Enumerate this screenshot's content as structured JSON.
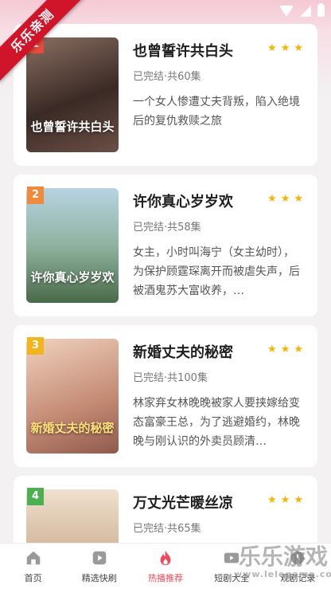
{
  "ribbon": {
    "text": "乐乐亲测"
  },
  "dramas": [
    {
      "rank": "1",
      "rank_color": "#e84a3c",
      "title": "也曾誓许共白头",
      "cover_title": "也曾誓许共白头",
      "status": "已完结·共60集",
      "desc": "一个女人惨遭丈夫背叛，陷入绝境后的复仇救赎之旅",
      "cover_colors": [
        "#7a5f54",
        "#3a2a25"
      ]
    },
    {
      "rank": "2",
      "rank_color": "#f08a3c",
      "title": "许你真心岁岁欢",
      "cover_title": "许你真心岁岁欢",
      "status": "已完结·共58集",
      "desc": "女主，小时叫海宁（女主幼时），为保护顾霆琛离开而被虐失声，后被酒鬼苏大富收养，…",
      "cover_colors": [
        "#9bbfd4",
        "#5c7f5a"
      ]
    },
    {
      "rank": "3",
      "rank_color": "#f2b51e",
      "title": "新婚丈夫的秘密",
      "cover_title": "新婚丈夫的秘密",
      "status": "已完结·共100集",
      "desc": "林家弃女林晚晚被家人要挟嫁给变态富豪王总，为了逃避婚约，林晚晚与刚认识的外卖员顾清…",
      "cover_colors": [
        "#e8c0a8",
        "#b87c6a"
      ]
    },
    {
      "rank": "4",
      "rank_color": "#4caf50",
      "title": "万丈光芒暖丝凉",
      "cover_title": "",
      "status": "已完结·共65集",
      "desc": "",
      "cover_colors": [
        "#e8d6c2",
        "#b89a7c"
      ]
    }
  ],
  "tabs": [
    {
      "label": "首页",
      "icon": "home-icon",
      "active": false
    },
    {
      "label": "精选快刷",
      "icon": "play-icon",
      "active": false
    },
    {
      "label": "热播推荐",
      "icon": "flame-icon",
      "active": true
    },
    {
      "label": "短剧大全",
      "icon": "video-icon",
      "active": false
    },
    {
      "label": "观剧记录",
      "icon": "history-icon",
      "active": false
    }
  ],
  "watermark": {
    "text": "乐乐游戏",
    "url": "www.lelegame.com"
  },
  "colors": {
    "accent": "#f04a5a",
    "star": "#f5b400"
  }
}
